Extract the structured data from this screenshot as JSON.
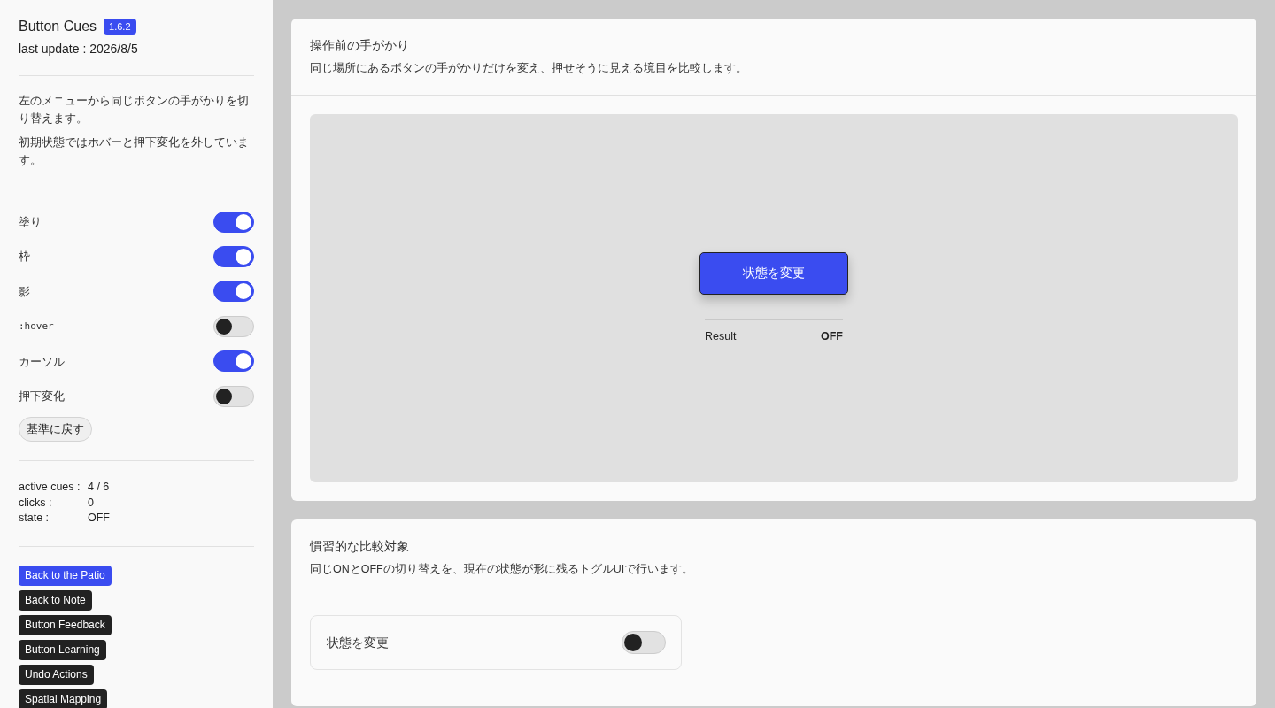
{
  "sidebar": {
    "title": "Button Cues",
    "version": "1.6.2",
    "last_update": "last update : 2026/8/5",
    "notes": [
      "左のメニューから同じボタンの手がかりを切り替えます。",
      "初期状態ではホバーと押下変化を外しています。"
    ],
    "cues": [
      {
        "label": "塗り",
        "kind": "text",
        "on": true
      },
      {
        "label": "枠",
        "kind": "text",
        "on": true
      },
      {
        "label": "影",
        "kind": "text",
        "on": true
      },
      {
        "label": ":hover",
        "kind": "code",
        "on": false
      },
      {
        "label": "カーソル",
        "kind": "text",
        "on": true
      },
      {
        "label": "押下変化",
        "kind": "text",
        "on": false
      }
    ],
    "reset_button": "基準に戻す",
    "stats": [
      {
        "label": "active cues :",
        "value": "4 / 6"
      },
      {
        "label": "clicks :",
        "value": "0"
      },
      {
        "label": "state :",
        "value": "OFF"
      }
    ],
    "links": [
      {
        "label": "Back to the Patio",
        "selected": true
      },
      {
        "label": "Back to Note",
        "selected": false
      },
      {
        "label": "Button Feedback",
        "selected": false
      },
      {
        "label": "Button Learning",
        "selected": false
      },
      {
        "label": "Undo Actions",
        "selected": false
      },
      {
        "label": "Spatial Mapping",
        "selected": false
      }
    ]
  },
  "panels": [
    {
      "kind": "cue-button",
      "title": "操作前の手がかり",
      "description": "同じ場所にあるボタンの手がかりだけを変え、押せそうに見える境目を比較します。",
      "button": "状態を変更",
      "result_label": "Result",
      "result_value": "OFF"
    },
    {
      "kind": "toggle",
      "title": "慣習的な比較対象",
      "description": "同じONとOFFの切り替えを、現在の状態が形に残るトグルUIで行います。",
      "toggle_label": "状態を変更",
      "on": false
    }
  ]
}
